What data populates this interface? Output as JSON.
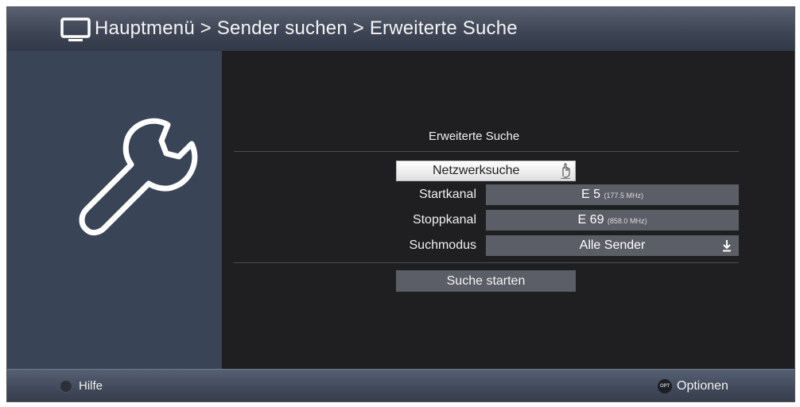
{
  "header": {
    "icon": "tv-icon",
    "breadcrumb": "Hauptmenü > Sender suchen > Erweiterte Suche"
  },
  "sidebar": {
    "icon": "wrench-icon"
  },
  "form": {
    "title": "Erweiterte Suche",
    "search_type_button": "Netzwerksuche",
    "rows": [
      {
        "label": "Startkanal",
        "value": "E 5",
        "detail": "(177.5 MHz)"
      },
      {
        "label": "Stoppkanal",
        "value": "E 69",
        "detail": "(858.0 MHz)"
      },
      {
        "label": "Suchmodus",
        "value": "Alle Sender",
        "detail": ""
      }
    ],
    "start_button": "Suche starten"
  },
  "footer": {
    "help_label": "Hilfe",
    "options_key": "OPT",
    "options_label": "Optionen"
  },
  "colors": {
    "background": "#1f1f21",
    "panel": "#3a4457",
    "field": "#5b5e66",
    "header": "#3e4656"
  }
}
